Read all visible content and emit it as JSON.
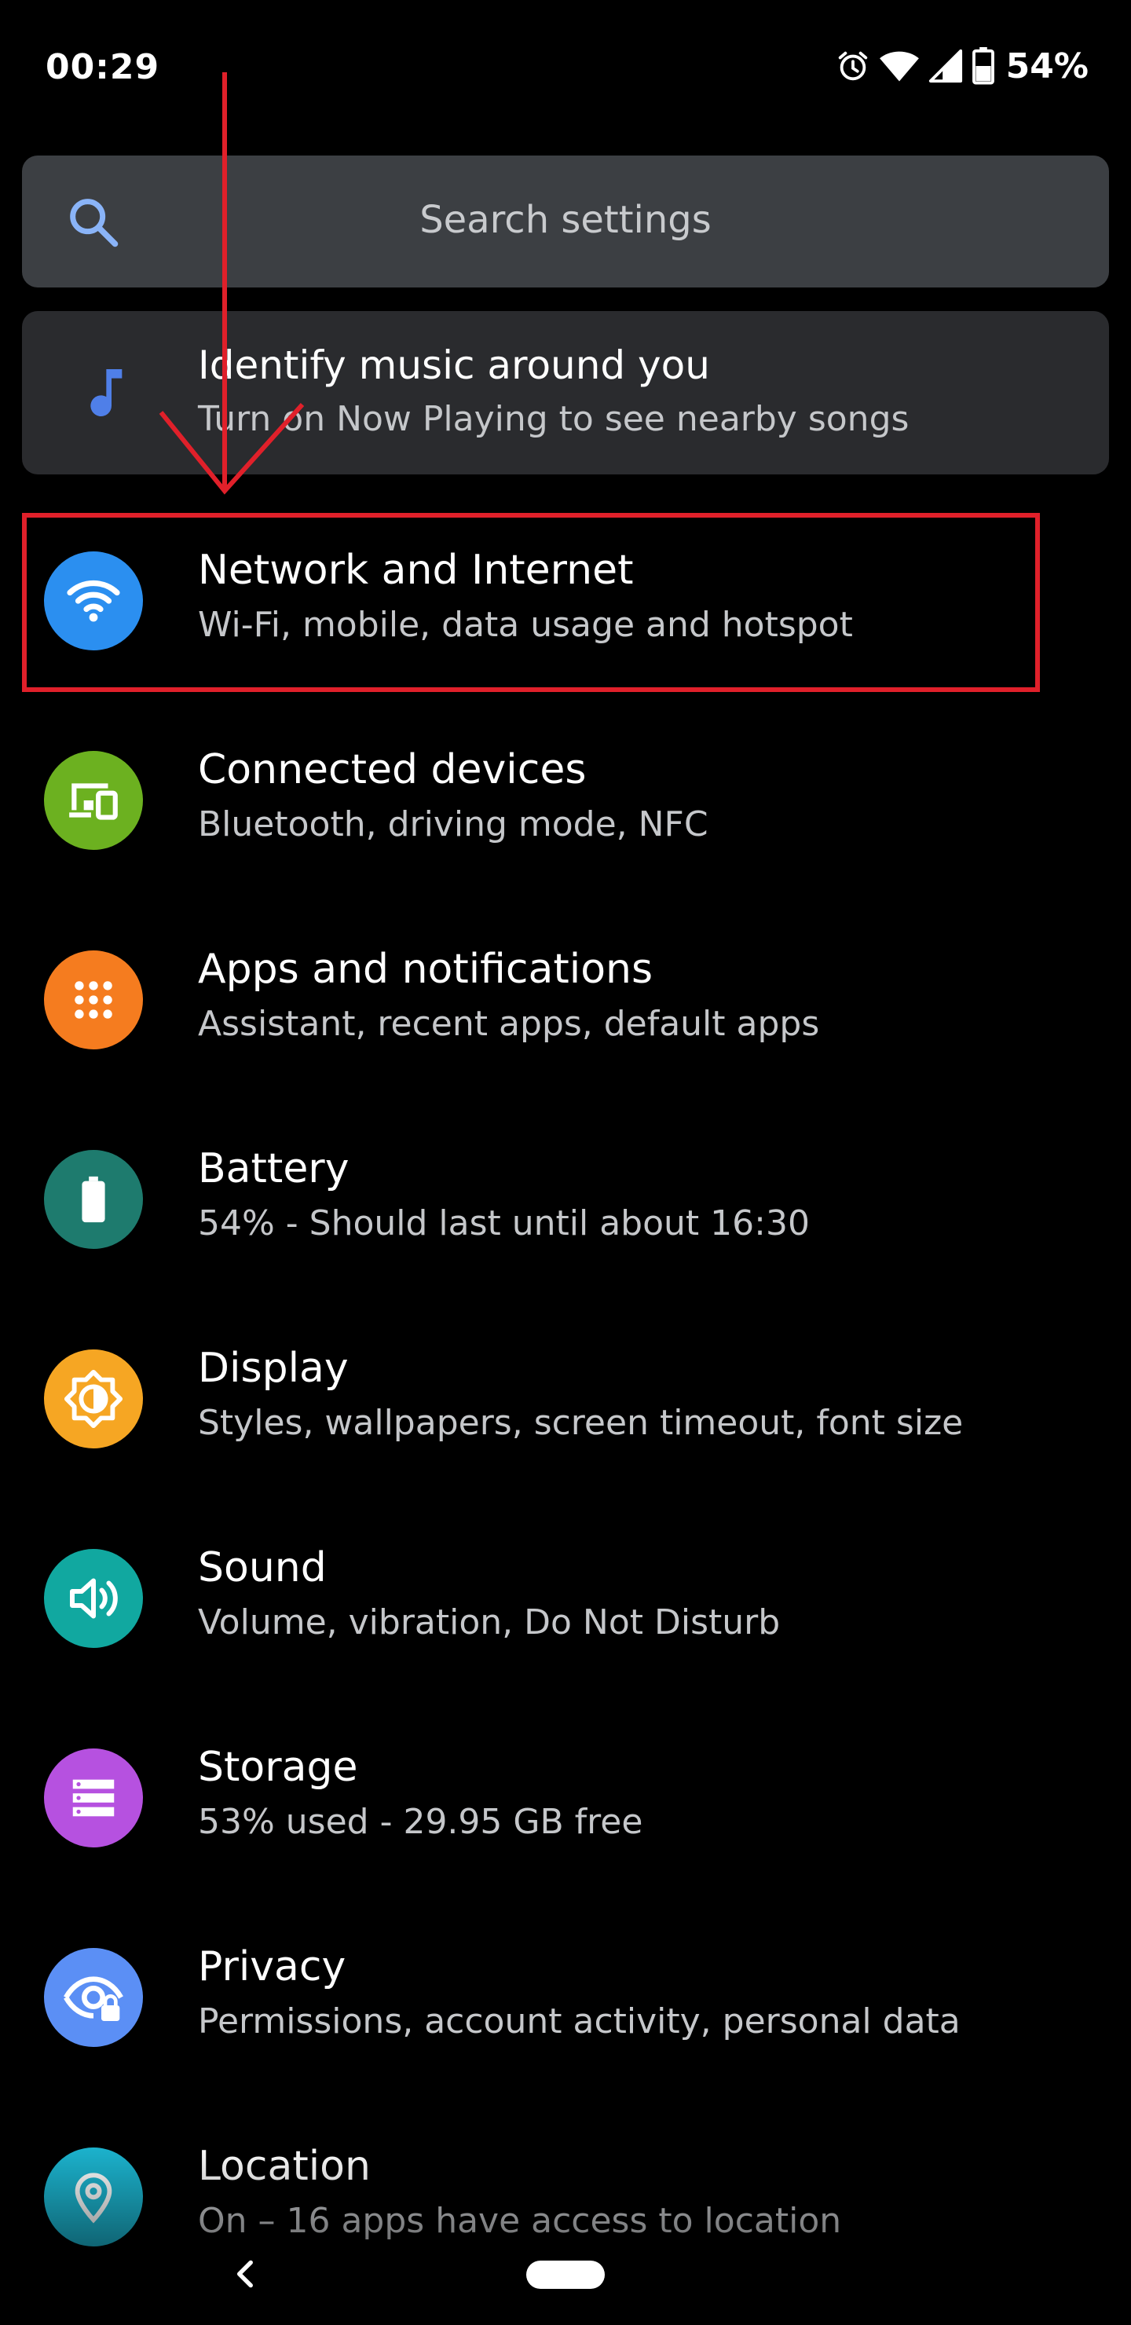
{
  "status_bar": {
    "time": "00:29",
    "battery_percent": "54%",
    "icons": [
      "alarm-icon",
      "wifi-icon",
      "cell-signal-icon",
      "battery-icon"
    ]
  },
  "search": {
    "placeholder": "Search settings",
    "icon": "search-icon"
  },
  "suggestion": {
    "title": "Identify music around you",
    "subtitle": "Turn on Now Playing to see nearby songs",
    "icon": "music-note-icon",
    "accent": "#4f7fe8"
  },
  "settings": [
    {
      "title": "Network and Internet",
      "subtitle": "Wi-Fi, mobile, data usage and hotspot",
      "icon": "wifi-icon",
      "color": "#2b8ff0"
    },
    {
      "title": "Connected devices",
      "subtitle": "Bluetooth, driving mode, NFC",
      "icon": "devices-icon",
      "color": "#6cb120"
    },
    {
      "title": "Apps and notifications",
      "subtitle": "Assistant, recent apps, default apps",
      "icon": "apps-grid-icon",
      "color": "#f57c1f"
    },
    {
      "title": "Battery",
      "subtitle": "54% - Should last until about 16:30",
      "icon": "battery-icon",
      "color": "#1e7b6e"
    },
    {
      "title": "Display",
      "subtitle": "Styles, wallpapers, screen timeout, font size",
      "icon": "brightness-icon",
      "color": "#f6a623"
    },
    {
      "title": "Sound",
      "subtitle": "Volume, vibration, Do Not Disturb",
      "icon": "volume-icon",
      "color": "#11a8a0"
    },
    {
      "title": "Storage",
      "subtitle": "53% used - 29.95 GB free",
      "icon": "storage-icon",
      "color": "#b651e0"
    },
    {
      "title": "Privacy",
      "subtitle": "Permissions, account activity, personal data",
      "icon": "privacy-eye-icon",
      "color": "#5b8ff5"
    },
    {
      "title": "Location",
      "subtitle": "On – 16 apps have access to location",
      "icon": "location-pin-icon",
      "color": "#1cb5d0"
    }
  ],
  "annotation": {
    "highlight_color": "#e0202a",
    "highlighted_item": "Network and Internet"
  },
  "nav": {
    "back_icon": "back-chevron-icon",
    "home_icon": "home-pill-icon"
  }
}
